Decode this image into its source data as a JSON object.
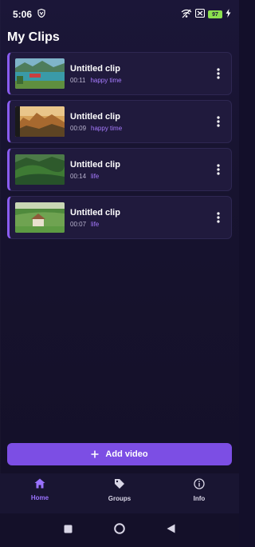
{
  "status": {
    "time": "5:06",
    "battery": "97",
    "icons": [
      "vpn-shield-icon",
      "wifi-off-icon",
      "signal-off-icon",
      "battery-icon",
      "charging-bolt-icon"
    ]
  },
  "page": {
    "title": "My Clips"
  },
  "clips": [
    {
      "title": "Untitled clip",
      "duration": "00:11",
      "tag": "happy time",
      "thumb": "river-boat-landscape"
    },
    {
      "title": "Untitled clip",
      "duration": "00:09",
      "tag": "happy time",
      "thumb": "sunset-mountains"
    },
    {
      "title": "Untitled clip",
      "duration": "00:14",
      "tag": "life",
      "thumb": "green-hills"
    },
    {
      "title": "Untitled clip",
      "duration": "00:07",
      "tag": "life",
      "thumb": "green-field-house"
    }
  ],
  "actions": {
    "add_video_label": "Add video",
    "add_icon": "plus-icon"
  },
  "nav": {
    "items": [
      {
        "label": "Home",
        "icon": "home-icon",
        "active": true
      },
      {
        "label": "Groups",
        "icon": "tag-icon",
        "active": false
      },
      {
        "label": "Info",
        "icon": "info-icon",
        "active": false
      }
    ]
  },
  "colors": {
    "background": "#141029",
    "card": "#201a3d",
    "accent": "#7c4ee4",
    "tag": "#a77bff",
    "active_nav": "#9a72ff"
  }
}
